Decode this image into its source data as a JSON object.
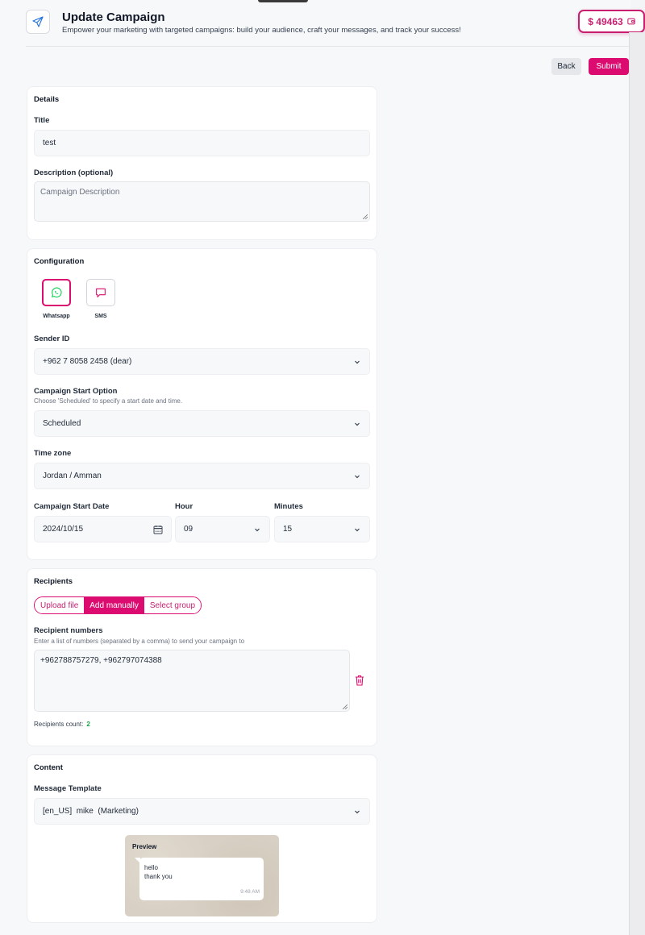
{
  "header": {
    "title": "Update Campaign",
    "subtitle": "Empower your marketing with targeted campaigns: build your audience, craft your messages, and track your success!",
    "balance": "$ 49463"
  },
  "actions": {
    "back": "Back",
    "submit": "Submit"
  },
  "details": {
    "heading": "Details",
    "title_label": "Title",
    "title_value": "test",
    "description_label": "Description (optional)",
    "description_placeholder": "Campaign Description"
  },
  "configuration": {
    "heading": "Configuration",
    "channels": [
      {
        "label": "Whatsapp",
        "selected": true
      },
      {
        "label": "SMS",
        "selected": false
      }
    ],
    "sender_label": "Sender ID",
    "sender_value": "+962 7 8058 2458 (dear)",
    "start_option_label": "Campaign Start Option",
    "start_option_hint": "Choose 'Scheduled' to specify a start date and time.",
    "start_option_value": "Scheduled",
    "timezone_label": "Time zone",
    "timezone_value": "Jordan / Amman",
    "start_date_label": "Campaign Start Date",
    "start_date_value": "2024/10/15",
    "hour_label": "Hour",
    "hour_value": "09",
    "minutes_label": "Minutes",
    "minutes_value": "15"
  },
  "recipients": {
    "heading": "Recipients",
    "tabs": [
      "Upload file",
      "Add manually",
      "Select group"
    ],
    "active_tab": "Add manually",
    "numbers_label": "Recipient numbers",
    "numbers_hint": "Enter a list of numbers (separated by a comma) to send your campaign to",
    "numbers_value": "+962788757279, +962797074388",
    "count_label": "Recipients count:",
    "count_value": "2"
  },
  "content": {
    "heading": "Content",
    "template_label": "Message Template",
    "template_value": "[en_US]  mike  (Marketing)",
    "preview_title": "Preview",
    "preview_line1": "hello",
    "preview_line2": "thank you",
    "preview_time": "9:48 AM"
  },
  "colors": {
    "accent": "#db0b6f",
    "whatsapp": "#25d366",
    "count": "#16a34a"
  }
}
